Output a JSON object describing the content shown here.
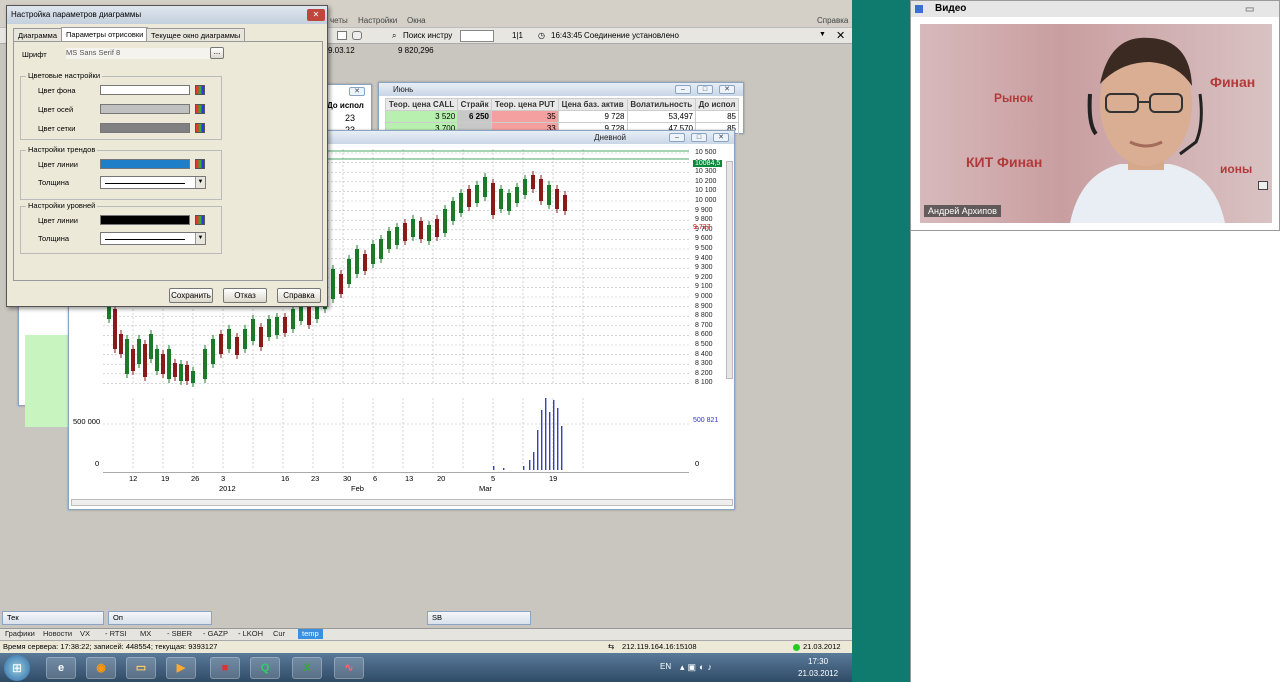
{
  "app": {
    "menu": [
      "четы",
      "Настройки",
      "Окна"
    ],
    "help": "Справка"
  },
  "toolbar": {
    "search_label": "Поиск инстру",
    "page": "1|1",
    "time": "16:43:45",
    "connection": "Соединение установлено",
    "value1": "9.03.12",
    "value2": "9 820,296"
  },
  "options_window": {
    "title": "Июнь",
    "headers": [
      "Теор. цена CALL",
      "Страйк",
      "Теор. цена PUT",
      "Цена баз. актив",
      "Волатильность",
      "До испол"
    ],
    "rows": [
      [
        "3 520",
        "6 250",
        "35",
        "9 728",
        "53,497",
        "85"
      ],
      [
        "3 700",
        "",
        "33",
        "9 728",
        "47 570",
        "85"
      ]
    ],
    "left_header": "До испол",
    "left_rows": [
      "23",
      "23"
    ],
    "colors": {
      "call": "#b8f0b0",
      "strike": "#c8c8c8",
      "put": "#f4a0a0"
    }
  },
  "chart": {
    "title": "Дневной",
    "y_ticks": [
      "10 500",
      "10 400",
      "10 300",
      "10 200",
      "10 100",
      "10 000",
      "9 900",
      "9 800",
      "9 700",
      "9 600",
      "9 500",
      "9 400",
      "9 300",
      "9 200",
      "9 100",
      "9 000",
      "8 900",
      "8 800",
      "8 700",
      "8 600",
      "8 500",
      "8 400",
      "8 300",
      "8 200",
      "8 100"
    ],
    "last_price": "10084,5",
    "current": "9 727",
    "volume_ticks": [
      "500 000",
      "0"
    ],
    "volume_right": "500 821",
    "volume_zero": "0",
    "x_ticks": [
      "12",
      "19",
      "26",
      "3",
      "16",
      "23",
      "30",
      "6",
      "13",
      "20",
      "5",
      "19"
    ],
    "x_months": [
      "2012",
      "Feb",
      "Mar"
    ]
  },
  "chart_data": {
    "type": "candlestick",
    "ylim": [
      8100,
      10500
    ],
    "x": [
      "12",
      "19",
      "26",
      "3",
      "16",
      "23",
      "30",
      "6",
      "13",
      "20",
      "5",
      "19"
    ]
  },
  "dialog": {
    "title": "Настройка параметров диаграммы",
    "tabs": [
      "Диаграмма",
      "Параметры отрисовки",
      "Текущее окно диаграммы"
    ],
    "font_label": "Шрифт",
    "font_value": "MS Sans Serif 8",
    "browse": "...",
    "group_colors": "Цветовые настройки",
    "bg": "Цвет фона",
    "axes": "Цвет осей",
    "gridc": "Цвет сетки",
    "group_trends": "Настройки трендов",
    "trend_color": "Цвет линии",
    "trend_width": "Толщина",
    "group_levels": "Настройки уровней",
    "level_color": "Цвет линии",
    "level_width": "Толщина",
    "save": "Сохранить",
    "cancel": "Отказ",
    "help": "Справка",
    "colors": {
      "bg": "#ffffff",
      "axes": "#c0c0c0",
      "grid": "#808080",
      "trend": "#1f7ec8",
      "level": "#000000"
    }
  },
  "mini_windows": [
    "Тек",
    "Оп",
    "SB"
  ],
  "bottom_tabs": [
    "Графики",
    "Новости",
    "VX",
    "- RTSI",
    "MX",
    "- SBER",
    "- GAZP",
    "- LKOH",
    "Cur",
    "temp"
  ],
  "status": {
    "server": "Время сервера: 17:38:22; записей: 448554; текущая: 9393127",
    "ip": "212.119.164.16:15108",
    "date": "21.03.2012"
  },
  "tray": {
    "lang": "EN",
    "time": "17:30",
    "date": "21.03.2012"
  },
  "video": {
    "title": "Видео",
    "person": "Андрей Архипов",
    "bg_words": [
      "Рынок",
      "Финан",
      "КИТ Финан",
      "ионы"
    ]
  }
}
